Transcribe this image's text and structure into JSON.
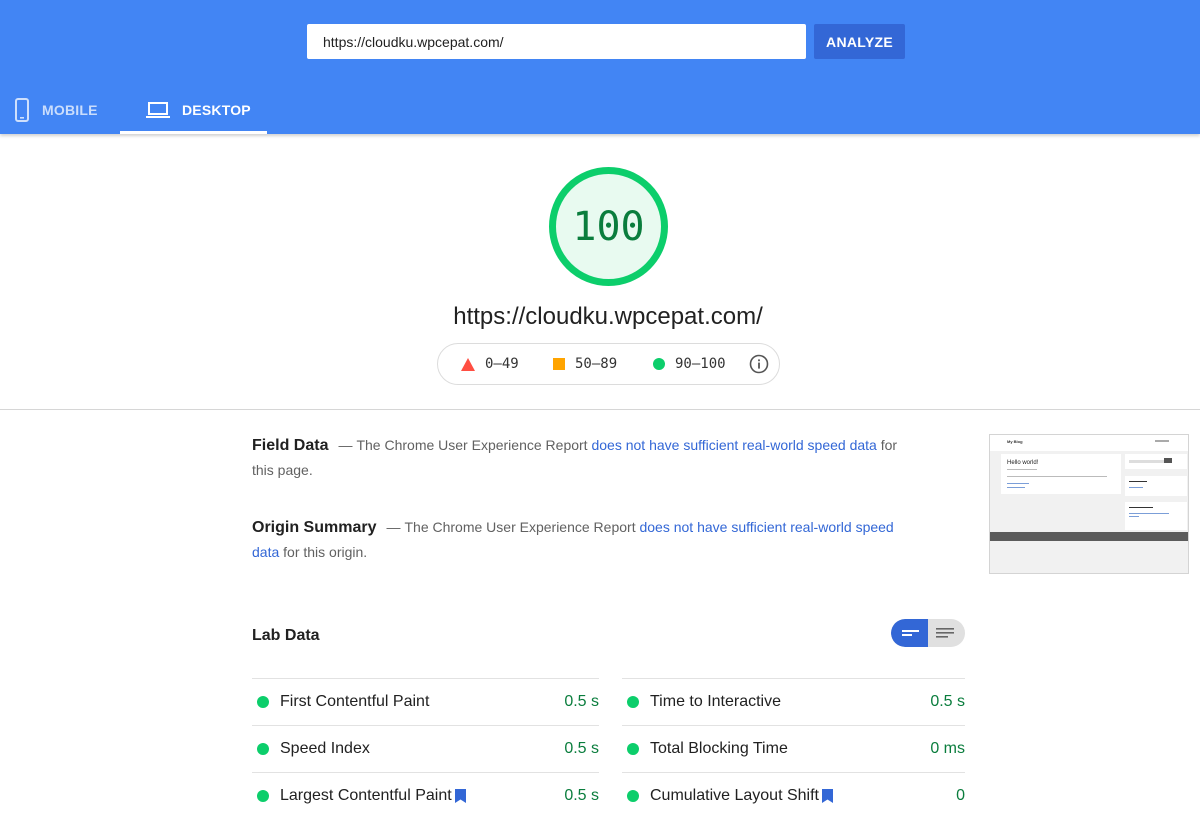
{
  "header": {
    "url_value": "https://cloudku.wpcepat.com/",
    "analyze_label": "ANALYZE",
    "tabs": [
      {
        "label": "MOBILE",
        "icon": "phone-icon",
        "active": false
      },
      {
        "label": "DESKTOP",
        "icon": "laptop-icon",
        "active": true
      }
    ],
    "bg_color": "#4285f4",
    "button_color": "#3367d6"
  },
  "score": {
    "value": 100,
    "display": "100",
    "url": "https://cloudku.wpcepat.com/",
    "color": "#0cce6b"
  },
  "legend": {
    "fail": {
      "range": "0–49",
      "icon": "red-triangle-icon",
      "color": "#ff4e42"
    },
    "average": {
      "range": "50–89",
      "icon": "orange-square-icon",
      "color": "#ffa400"
    },
    "pass": {
      "range": "90–100",
      "icon": "green-circle-icon",
      "color": "#0cce6b"
    },
    "info_icon": "info-icon"
  },
  "field_data": {
    "title": "Field Data",
    "dash": "—",
    "text_before": "The Chrome User Experience Report ",
    "link": "does not have sufficient real-world speed data",
    "text_after": " for this page."
  },
  "origin_summary": {
    "title": "Origin Summary",
    "dash": "—",
    "text_before": "The Chrome User Experience Report ",
    "link": "does not have sufficient real-world speed data",
    "text_after": " for this origin."
  },
  "thumbnail": {
    "site_title": "My Blog",
    "post_title": "Hello world!"
  },
  "lab_data": {
    "title": "Lab Data",
    "left": [
      {
        "name": "First Contentful Paint",
        "value": "0.5 s",
        "flag": false
      },
      {
        "name": "Speed Index",
        "value": "0.5 s",
        "flag": false
      },
      {
        "name": "Largest Contentful Paint",
        "value": "0.5 s",
        "flag": true
      }
    ],
    "right": [
      {
        "name": "Time to Interactive",
        "value": "0.5 s",
        "flag": false
      },
      {
        "name": "Total Blocking Time",
        "value": "0 ms",
        "flag": false
      },
      {
        "name": "Cumulative Layout Shift",
        "value": "0",
        "flag": true
      }
    ]
  }
}
